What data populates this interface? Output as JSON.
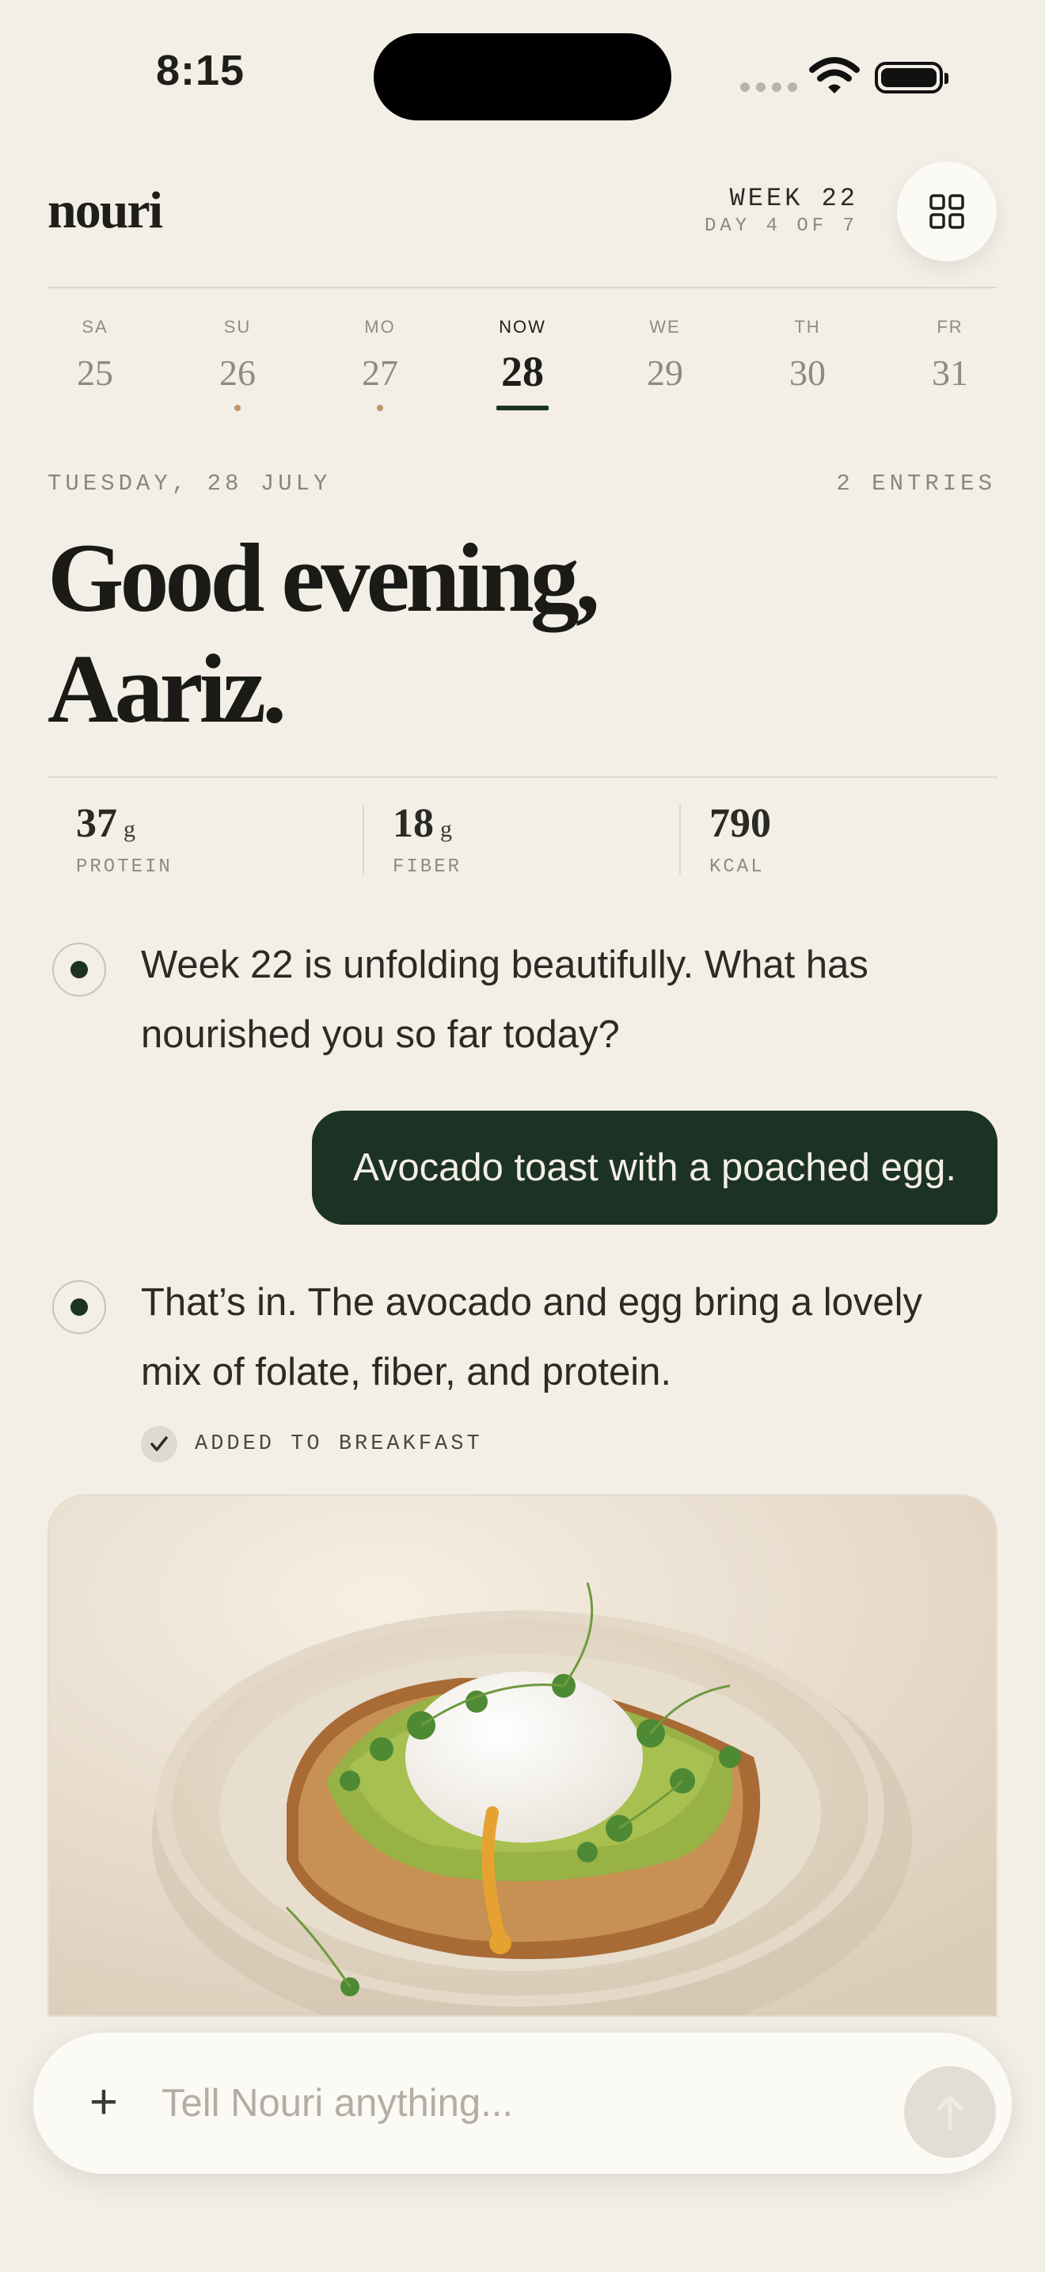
{
  "status": {
    "time": "8:15"
  },
  "header": {
    "logo": "nouri",
    "week_label": "WEEK 22",
    "day_of_label": "DAY 4 OF 7",
    "menu_icon": "grid-icon"
  },
  "days": [
    {
      "abbr": "SA",
      "num": "25",
      "active": false,
      "has_entry": false
    },
    {
      "abbr": "SU",
      "num": "26",
      "active": false,
      "has_entry": true
    },
    {
      "abbr": "MO",
      "num": "27",
      "active": false,
      "has_entry": true
    },
    {
      "abbr": "NOW",
      "num": "28",
      "active": true,
      "has_entry": false
    },
    {
      "abbr": "WE",
      "num": "29",
      "active": false,
      "has_entry": false
    },
    {
      "abbr": "TH",
      "num": "30",
      "active": false,
      "has_entry": false
    },
    {
      "abbr": "FR",
      "num": "31",
      "active": false,
      "has_entry": false
    }
  ],
  "date_line": "TUESDAY, 28 JULY",
  "entries_count": "2 ENTRIES",
  "greeting": {
    "line1": "Good evening,",
    "line2": "Aariz."
  },
  "stats": [
    {
      "value": "37",
      "unit": "g",
      "label": "PROTEIN"
    },
    {
      "value": "18",
      "unit": "g",
      "label": "FIBER"
    },
    {
      "value": "790",
      "unit": "",
      "label": "KCAL"
    }
  ],
  "chat": {
    "bot_1": "Week 22 is unfolding beautifully. What has nourished you so far today?",
    "user_1": "Avocado toast with a poached egg.",
    "bot_2": "That’s in. The avocado and egg bring a lovely mix of folate, fiber, and protein.",
    "added_label": "ADDED TO BREAKFAST"
  },
  "photo": {
    "subject": "avocado toast with poached egg"
  },
  "composer": {
    "placeholder": "Tell Nouri anything..."
  },
  "colors": {
    "background": "#f3efe6",
    "accent_dark_green": "#1c3224",
    "dot_tan": "#c29563"
  }
}
